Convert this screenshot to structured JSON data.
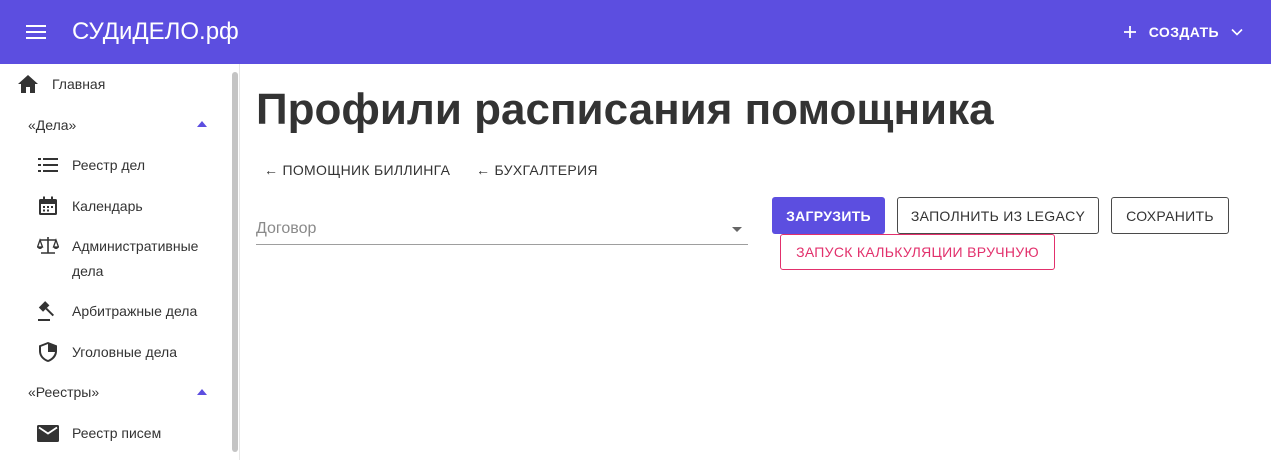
{
  "app": {
    "title": "СУДиДЕЛО.рф",
    "create_label": "СОЗДАТЬ",
    "accent_color": "#5c4ee0",
    "danger_color": "#e2306c"
  },
  "sidebar": {
    "home": {
      "label": "Главная",
      "icon": "home-icon"
    },
    "sections": [
      {
        "title": "«Дела»",
        "expanded": true,
        "items": [
          {
            "label": "Реестр дел",
            "icon": "list-icon"
          },
          {
            "label": "Календарь",
            "icon": "calendar-icon"
          },
          {
            "label": "Административные",
            "label2": "дела",
            "icon": "scales-icon"
          },
          {
            "label": "Арбитражные дела",
            "icon": "gavel-icon"
          },
          {
            "label": "Уголовные дела",
            "icon": "shield-icon"
          }
        ]
      },
      {
        "title": "«Реестры»",
        "expanded": true,
        "items": [
          {
            "label": "Реестр писем",
            "icon": "mail-icon"
          }
        ]
      }
    ]
  },
  "main": {
    "title": "Профили расписания помощника",
    "breadcrumbs": [
      {
        "label": "← ПОМОЩНИК БИЛЛИНГА"
      },
      {
        "label": "← БУХГАЛТЕРИЯ"
      }
    ],
    "contract_select": {
      "placeholder": "Договор",
      "value": ""
    },
    "buttons": {
      "load": "ЗАГРУЗИТЬ",
      "fill_legacy": "ЗАПОЛНИТЬ ИЗ LEGACY",
      "save": "СОХРАНИТЬ",
      "manual_calc": "ЗАПУСК КАЛЬКУЛЯЦИИ ВРУЧНУЮ"
    }
  }
}
